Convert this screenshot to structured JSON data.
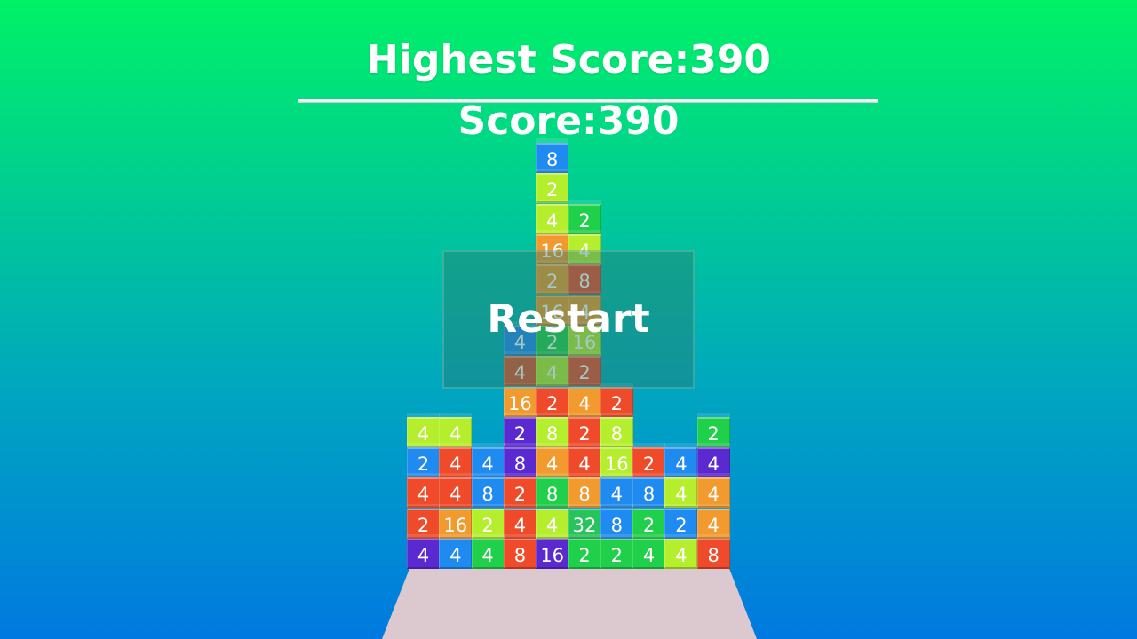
{
  "hud": {
    "highest_score": "Highest Score:390",
    "score": "Score:390"
  },
  "overlay": {
    "restart_label": "Restart"
  },
  "colors": {
    "bg_top": "#00f266",
    "bg_bottom": "#0079e0",
    "platform": "#dcc8cf"
  },
  "board": {
    "blocks": [
      {
        "col": 4,
        "row": 14,
        "v": "8",
        "c": "bblue"
      },
      {
        "col": 4,
        "row": 13,
        "v": "2",
        "c": "b4"
      },
      {
        "col": 4,
        "row": 12,
        "v": "4",
        "c": "b4"
      },
      {
        "col": 5,
        "row": 12,
        "v": "2",
        "c": "b2"
      },
      {
        "col": 4,
        "row": 11,
        "v": "16",
        "c": "b16"
      },
      {
        "col": 5,
        "row": 11,
        "v": "4",
        "c": "b4"
      },
      {
        "col": 4,
        "row": 10,
        "v": "2",
        "c": "b16"
      },
      {
        "col": 5,
        "row": 10,
        "v": "8",
        "c": "bred"
      },
      {
        "col": 4,
        "row": 9,
        "v": "16",
        "c": "b16"
      },
      {
        "col": 5,
        "row": 9,
        "v": "4",
        "c": "b16"
      },
      {
        "col": 3,
        "row": 8,
        "v": "4",
        "c": "bblue"
      },
      {
        "col": 4,
        "row": 8,
        "v": "2",
        "c": "b2"
      },
      {
        "col": 5,
        "row": 8,
        "v": "16",
        "c": "b4"
      },
      {
        "col": 3,
        "row": 7,
        "v": "4",
        "c": "bdred"
      },
      {
        "col": 4,
        "row": 7,
        "v": "4",
        "c": "b4"
      },
      {
        "col": 5,
        "row": 7,
        "v": "2",
        "c": "bred"
      },
      {
        "col": 3,
        "row": 6,
        "v": "16",
        "c": "b16"
      },
      {
        "col": 4,
        "row": 6,
        "v": "2",
        "c": "bred"
      },
      {
        "col": 5,
        "row": 6,
        "v": "4",
        "c": "b16"
      },
      {
        "col": 6,
        "row": 6,
        "v": "2",
        "c": "bred"
      },
      {
        "col": 0,
        "row": 5,
        "v": "4",
        "c": "b4"
      },
      {
        "col": 1,
        "row": 5,
        "v": "4",
        "c": "b4"
      },
      {
        "col": 3,
        "row": 5,
        "v": "2",
        "c": "bpurple"
      },
      {
        "col": 4,
        "row": 5,
        "v": "8",
        "c": "b4"
      },
      {
        "col": 5,
        "row": 5,
        "v": "2",
        "c": "bred"
      },
      {
        "col": 6,
        "row": 5,
        "v": "8",
        "c": "b4"
      },
      {
        "col": 9,
        "row": 5,
        "v": "2",
        "c": "b2"
      },
      {
        "col": 0,
        "row": 4,
        "v": "2",
        "c": "bblue"
      },
      {
        "col": 1,
        "row": 4,
        "v": "4",
        "c": "bred"
      },
      {
        "col": 2,
        "row": 4,
        "v": "4",
        "c": "bblue"
      },
      {
        "col": 3,
        "row": 4,
        "v": "8",
        "c": "bpurple"
      },
      {
        "col": 4,
        "row": 4,
        "v": "4",
        "c": "b16"
      },
      {
        "col": 5,
        "row": 4,
        "v": "4",
        "c": "bred"
      },
      {
        "col": 6,
        "row": 4,
        "v": "16",
        "c": "b4"
      },
      {
        "col": 7,
        "row": 4,
        "v": "2",
        "c": "bred"
      },
      {
        "col": 8,
        "row": 4,
        "v": "4",
        "c": "bblue"
      },
      {
        "col": 9,
        "row": 4,
        "v": "4",
        "c": "bpurple"
      },
      {
        "col": 0,
        "row": 3,
        "v": "4",
        "c": "bred"
      },
      {
        "col": 1,
        "row": 3,
        "v": "4",
        "c": "bred"
      },
      {
        "col": 2,
        "row": 3,
        "v": "8",
        "c": "bblue"
      },
      {
        "col": 3,
        "row": 3,
        "v": "2",
        "c": "bred"
      },
      {
        "col": 4,
        "row": 3,
        "v": "8",
        "c": "b2"
      },
      {
        "col": 5,
        "row": 3,
        "v": "8",
        "c": "b16"
      },
      {
        "col": 6,
        "row": 3,
        "v": "4",
        "c": "bblue"
      },
      {
        "col": 7,
        "row": 3,
        "v": "8",
        "c": "bblue"
      },
      {
        "col": 8,
        "row": 3,
        "v": "4",
        "c": "b4"
      },
      {
        "col": 9,
        "row": 3,
        "v": "4",
        "c": "b16"
      },
      {
        "col": 0,
        "row": 2,
        "v": "2",
        "c": "bred"
      },
      {
        "col": 1,
        "row": 2,
        "v": "16",
        "c": "b16"
      },
      {
        "col": 2,
        "row": 2,
        "v": "2",
        "c": "b4"
      },
      {
        "col": 3,
        "row": 2,
        "v": "4",
        "c": "bred"
      },
      {
        "col": 4,
        "row": 2,
        "v": "4",
        "c": "b4"
      },
      {
        "col": 5,
        "row": 2,
        "v": "32",
        "c": "b32"
      },
      {
        "col": 6,
        "row": 2,
        "v": "8",
        "c": "bblue"
      },
      {
        "col": 7,
        "row": 2,
        "v": "2",
        "c": "b2"
      },
      {
        "col": 8,
        "row": 2,
        "v": "2",
        "c": "bblue"
      },
      {
        "col": 9,
        "row": 2,
        "v": "4",
        "c": "b16"
      },
      {
        "col": 0,
        "row": 1,
        "v": "4",
        "c": "bpurple"
      },
      {
        "col": 1,
        "row": 1,
        "v": "4",
        "c": "bblue"
      },
      {
        "col": 2,
        "row": 1,
        "v": "4",
        "c": "b2"
      },
      {
        "col": 3,
        "row": 1,
        "v": "8",
        "c": "bred"
      },
      {
        "col": 4,
        "row": 1,
        "v": "16",
        "c": "bpurple"
      },
      {
        "col": 5,
        "row": 1,
        "v": "2",
        "c": "b2"
      },
      {
        "col": 6,
        "row": 1,
        "v": "2",
        "c": "b2"
      },
      {
        "col": 7,
        "row": 1,
        "v": "4",
        "c": "b2"
      },
      {
        "col": 8,
        "row": 1,
        "v": "4",
        "c": "b4"
      },
      {
        "col": 9,
        "row": 1,
        "v": "8",
        "c": "bred"
      }
    ]
  }
}
